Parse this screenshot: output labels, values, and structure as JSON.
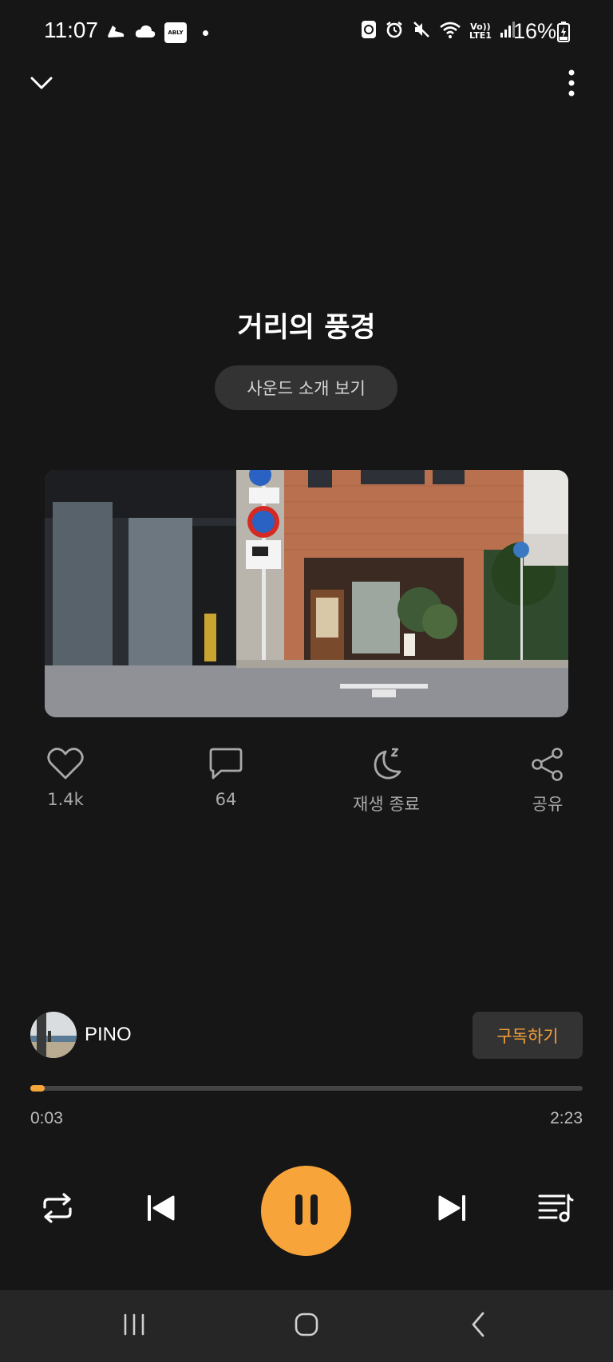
{
  "status_bar": {
    "time": "11:07",
    "ably_label": "ABLY",
    "network_label_top": "Vo))",
    "network_label_bottom": "LTE1",
    "battery": "16%"
  },
  "track": {
    "title": "거리의 풍경",
    "intro_button": "사운드 소개 보기"
  },
  "actions": {
    "like_count": "1.4k",
    "comment_count": "64",
    "sleep_label": "재생 종료",
    "share_label": "공유"
  },
  "artist": {
    "name": "PINO",
    "subscribe_label": "구독하기"
  },
  "playback": {
    "current_time": "0:03",
    "total_time": "2:23",
    "progress_fraction": 0.021,
    "state": "playing"
  },
  "colors": {
    "accent": "#f7a43a",
    "background": "#161616",
    "chip": "#333333"
  },
  "icons": [
    "chevron-down-icon",
    "more-vert-icon",
    "heart-icon",
    "comment-icon",
    "sleep-timer-icon",
    "share-icon",
    "repeat-icon",
    "skip-previous-icon",
    "pause-icon",
    "skip-next-icon",
    "queue-music-icon"
  ]
}
